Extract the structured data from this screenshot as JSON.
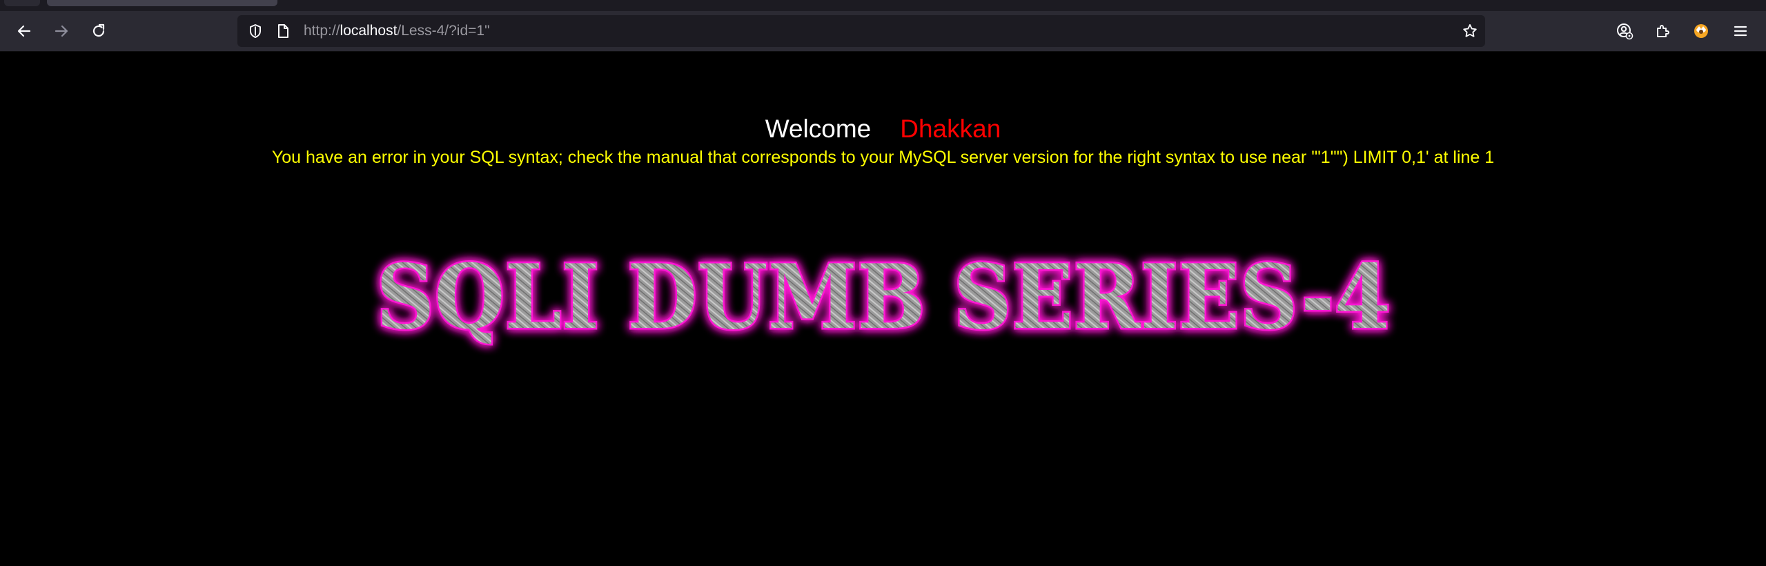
{
  "browser": {
    "url": {
      "prefix": "http://",
      "host": "localhost",
      "path": "/Less-4/?id=1\""
    },
    "icons": {
      "back": "arrow-left-icon",
      "forward": "arrow-right-icon",
      "reload": "reload-icon",
      "shield": "shield-icon",
      "page": "page-icon",
      "bookmark": "star-icon",
      "account": "account-icon",
      "extensions": "puzzle-icon",
      "profile": "fox-avatar-icon",
      "menu": "hamburger-menu-icon"
    }
  },
  "page": {
    "welcome_label": "Welcome",
    "welcome_name": "Dhakkan",
    "error_message": "You have an error in your SQL syntax; check the manual that corresponds to your MySQL server version for the right syntax to use near '\"1\"\") LIMIT 0,1' at line 1",
    "banner_text": "SQLI DUMB SERIES-4"
  },
  "colors": {
    "background": "#000000",
    "welcome": "#ffffff",
    "name": "#ff0000",
    "error": "#ffff00",
    "banner_glow": "#ff19d4",
    "banner_fill": "#a6a6a6"
  }
}
